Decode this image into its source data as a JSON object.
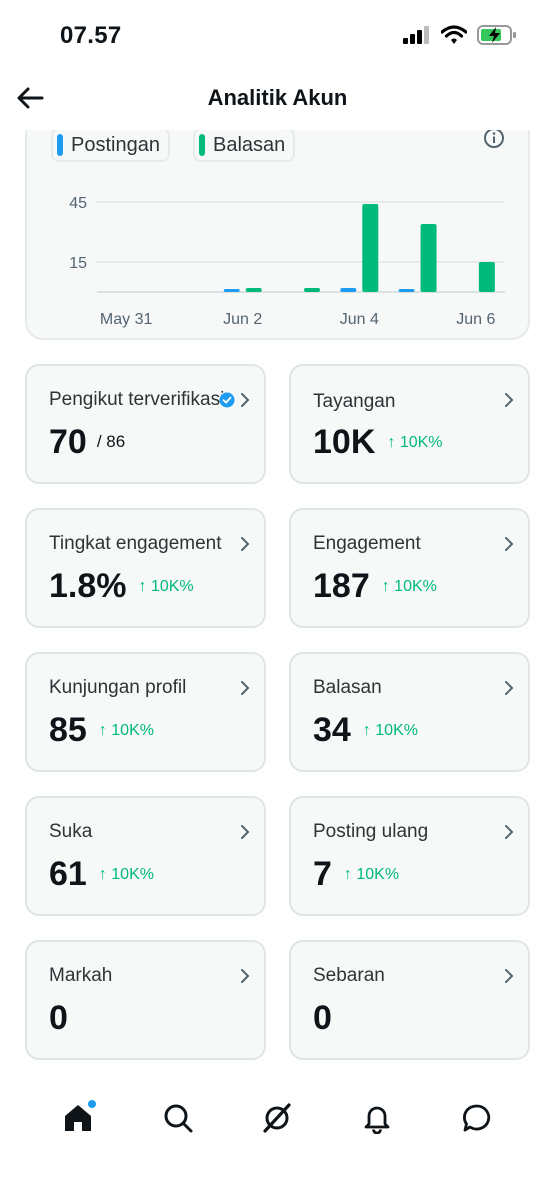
{
  "status": {
    "time": "07.57"
  },
  "header": {
    "title": "Analitik Akun"
  },
  "legend": [
    {
      "label": "Postingan",
      "color": "#1d9bf0"
    },
    {
      "label": "Balasan",
      "color": "#00ba7c"
    }
  ],
  "chart_data": {
    "type": "bar",
    "categories": [
      "May 31",
      "Jun 1",
      "Jun 2",
      "Jun 3",
      "Jun 4",
      "Jun 5",
      "Jun 6"
    ],
    "x_tick_labels": [
      "May 31",
      "Jun 2",
      "Jun 4",
      "Jun 6"
    ],
    "y_tick_labels": [
      "15",
      "45"
    ],
    "series": [
      {
        "name": "Postingan",
        "color": "#1d9bf0",
        "values": [
          0,
          0,
          1,
          0,
          2,
          1,
          0
        ]
      },
      {
        "name": "Balasan",
        "color": "#00ba7c",
        "values": [
          0,
          0,
          2,
          2,
          44,
          34,
          15
        ]
      }
    ],
    "ylim": [
      0,
      50
    ],
    "grid": true
  },
  "metrics": [
    {
      "label": "Pengikut terverifikasi",
      "value": "70",
      "sub": "/ 86",
      "change": "",
      "verified": true
    },
    {
      "label": "Tayangan",
      "value": "10K",
      "sub": "",
      "change": "↑ 10K%"
    },
    {
      "label": "Tingkat engagement",
      "value": "1.8%",
      "sub": "",
      "change": "↑ 10K%"
    },
    {
      "label": "Engagement",
      "value": "187",
      "sub": "",
      "change": "↑ 10K%"
    },
    {
      "label": "Kunjungan profil",
      "value": "85",
      "sub": "",
      "change": "↑ 10K%"
    },
    {
      "label": "Balasan",
      "value": "34",
      "sub": "",
      "change": "↑ 10K%"
    },
    {
      "label": "Suka",
      "value": "61",
      "sub": "",
      "change": "↑ 10K%"
    },
    {
      "label": "Posting ulang",
      "value": "7",
      "sub": "",
      "change": "↑ 10K%"
    },
    {
      "label": "Markah",
      "value": "0",
      "sub": "",
      "change": ""
    },
    {
      "label": "Sebaran",
      "value": "0",
      "sub": "",
      "change": ""
    }
  ],
  "nav": {
    "items": [
      "home-icon",
      "search-icon",
      "grok-icon",
      "bell-icon",
      "message-icon"
    ]
  },
  "colors": {
    "accent": "#1d9bf0",
    "positive": "#00ba7c"
  }
}
